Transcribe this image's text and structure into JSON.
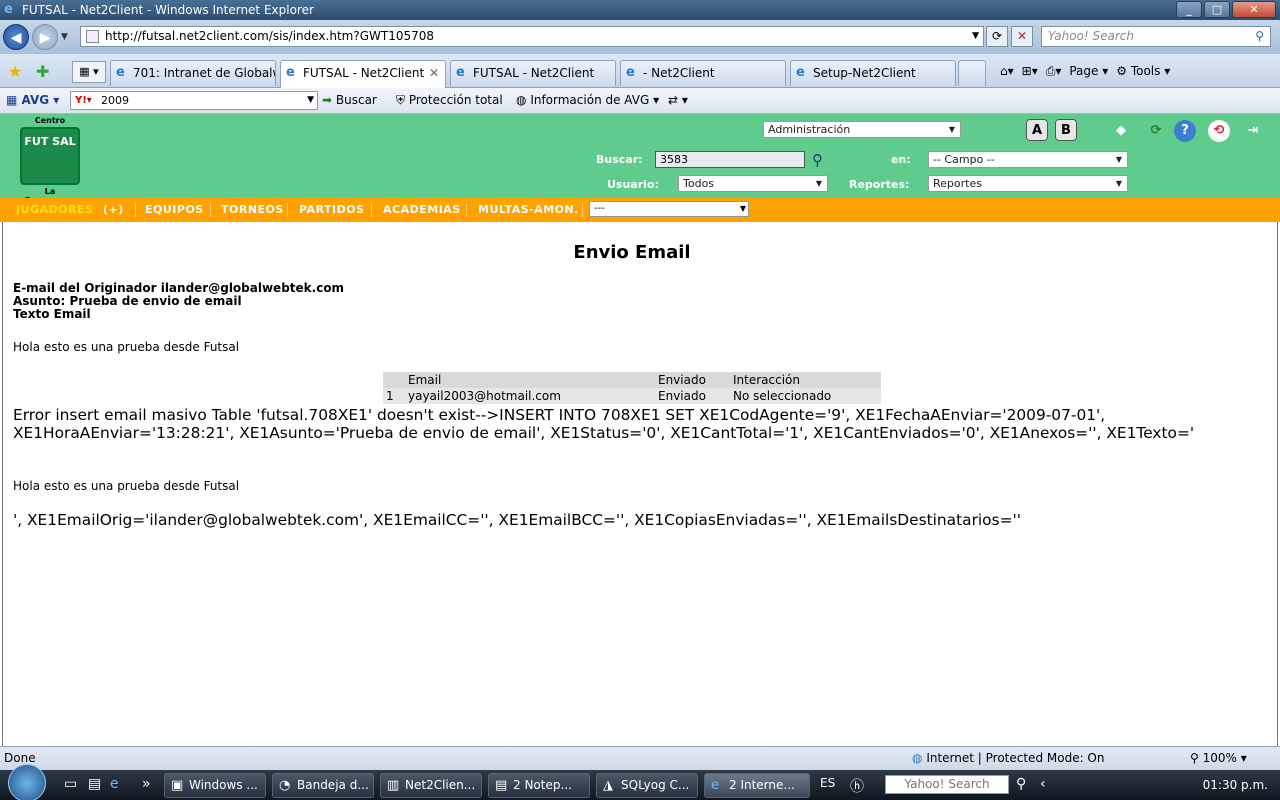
{
  "window": {
    "title": "FUTSAL - Net2Client - Windows Internet Explorer",
    "min": "_",
    "max": "□",
    "close": "✕"
  },
  "browser": {
    "address": "http://futsal.net2client.com/sis/index.htm?GWT105708",
    "search_placeholder": "Yahoo! Search",
    "tabs": [
      {
        "label": "701: Intranet de Globalw..."
      },
      {
        "label": "FUTSAL - Net2Client",
        "active": true
      },
      {
        "label": "FUTSAL - Net2Client"
      },
      {
        "label": "- Net2Client"
      },
      {
        "label": "Setup-Net2Client"
      }
    ],
    "commands": {
      "page": "Page",
      "tools": "Tools"
    }
  },
  "avg": {
    "logo": "AVG",
    "search_value": "2009",
    "buscar": "Buscar",
    "proteccion": "Protección total",
    "informacion": "Información de AVG"
  },
  "app": {
    "logo_top": "Centro",
    "logo_mid": "FUT SAL",
    "logo_bottom": "La Guacamaya",
    "admin_select": "Administración",
    "buscar_label": "Buscar:",
    "buscar_value": "3583",
    "en_label": "en:",
    "campo_select": "-- Campo --",
    "usuario_label": "Usuario:",
    "usuario_select": "Todos",
    "reportes_label": "Reportes:",
    "reportes_select": "Reportes",
    "font_a": "A",
    "font_b": "B",
    "menu": [
      {
        "label": "JUGADORES",
        "active": true
      },
      {
        "label": "(+)"
      },
      {
        "label": "EQUIPOS"
      },
      {
        "label": "TORNEOS"
      },
      {
        "label": "PARTIDOS"
      },
      {
        "label": "ACADEMIAS"
      },
      {
        "label": "MULTAS-AMON."
      }
    ],
    "menu_select": "---"
  },
  "page": {
    "title": "Envio Email",
    "originator": "E-mail del Originador ilander@globalwebtek.com",
    "subject": "Asunto: Prueba de envio de email",
    "text_label": "Texto Email",
    "body": "Hola esto es una prueba desde Futsal",
    "table": {
      "headers": [
        "",
        "Email",
        "Enviado",
        "Interacción"
      ],
      "rows": [
        [
          "1",
          "yayail2003@hotmail.com",
          "Enviado",
          "No seleccionado"
        ]
      ]
    },
    "error": "Error insert email masivo Table 'futsal.708XE1' doesn't exist-->INSERT INTO 708XE1 SET XE1CodAgente='9', XE1FechaAEnviar='2009-07-01', XE1HoraAEnviar='13:28:21', XE1Asunto='Prueba de envio de email', XE1Status='0', XE1CantTotal='1', XE1CantEnviados='0', XE1Anexos='', XE1Texto='",
    "body_repeat": "Hola esto es una prueba desde Futsal",
    "error_tail": "', XE1EmailOrig='ilander@globalwebtek.com', XE1EmailCC='', XE1EmailBCC='', XE1CopiasEnviadas='', XE1EmailsDestinatarios=''"
  },
  "status": {
    "left": "Done",
    "zone": "Internet | Protected Mode: On",
    "zoom": "100%"
  },
  "taskbar": {
    "buttons": [
      {
        "label": "Windows ..."
      },
      {
        "label": "Bandeja d..."
      },
      {
        "label": "Net2Clien..."
      },
      {
        "label": "2 Notep..."
      },
      {
        "label": "SQLyog C..."
      },
      {
        "label": "2 Interne...",
        "active": true
      }
    ],
    "lang": "ES",
    "search": "Yahoo! Search",
    "clock": "01:30 p.m."
  }
}
